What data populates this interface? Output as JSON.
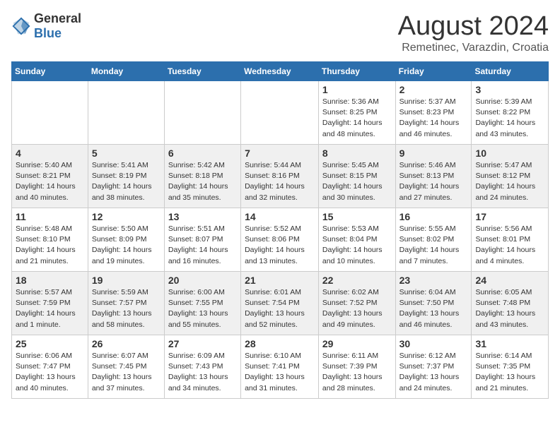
{
  "header": {
    "logo": {
      "general": "General",
      "blue": "Blue"
    },
    "month": "August 2024",
    "location": "Remetinec, Varazdin, Croatia"
  },
  "weekdays": [
    "Sunday",
    "Monday",
    "Tuesday",
    "Wednesday",
    "Thursday",
    "Friday",
    "Saturday"
  ],
  "weeks": [
    [
      {
        "day": "",
        "info": ""
      },
      {
        "day": "",
        "info": ""
      },
      {
        "day": "",
        "info": ""
      },
      {
        "day": "",
        "info": ""
      },
      {
        "day": "1",
        "info": "Sunrise: 5:36 AM\nSunset: 8:25 PM\nDaylight: 14 hours\nand 48 minutes."
      },
      {
        "day": "2",
        "info": "Sunrise: 5:37 AM\nSunset: 8:23 PM\nDaylight: 14 hours\nand 46 minutes."
      },
      {
        "day": "3",
        "info": "Sunrise: 5:39 AM\nSunset: 8:22 PM\nDaylight: 14 hours\nand 43 minutes."
      }
    ],
    [
      {
        "day": "4",
        "info": "Sunrise: 5:40 AM\nSunset: 8:21 PM\nDaylight: 14 hours\nand 40 minutes."
      },
      {
        "day": "5",
        "info": "Sunrise: 5:41 AM\nSunset: 8:19 PM\nDaylight: 14 hours\nand 38 minutes."
      },
      {
        "day": "6",
        "info": "Sunrise: 5:42 AM\nSunset: 8:18 PM\nDaylight: 14 hours\nand 35 minutes."
      },
      {
        "day": "7",
        "info": "Sunrise: 5:44 AM\nSunset: 8:16 PM\nDaylight: 14 hours\nand 32 minutes."
      },
      {
        "day": "8",
        "info": "Sunrise: 5:45 AM\nSunset: 8:15 PM\nDaylight: 14 hours\nand 30 minutes."
      },
      {
        "day": "9",
        "info": "Sunrise: 5:46 AM\nSunset: 8:13 PM\nDaylight: 14 hours\nand 27 minutes."
      },
      {
        "day": "10",
        "info": "Sunrise: 5:47 AM\nSunset: 8:12 PM\nDaylight: 14 hours\nand 24 minutes."
      }
    ],
    [
      {
        "day": "11",
        "info": "Sunrise: 5:48 AM\nSunset: 8:10 PM\nDaylight: 14 hours\nand 21 minutes."
      },
      {
        "day": "12",
        "info": "Sunrise: 5:50 AM\nSunset: 8:09 PM\nDaylight: 14 hours\nand 19 minutes."
      },
      {
        "day": "13",
        "info": "Sunrise: 5:51 AM\nSunset: 8:07 PM\nDaylight: 14 hours\nand 16 minutes."
      },
      {
        "day": "14",
        "info": "Sunrise: 5:52 AM\nSunset: 8:06 PM\nDaylight: 14 hours\nand 13 minutes."
      },
      {
        "day": "15",
        "info": "Sunrise: 5:53 AM\nSunset: 8:04 PM\nDaylight: 14 hours\nand 10 minutes."
      },
      {
        "day": "16",
        "info": "Sunrise: 5:55 AM\nSunset: 8:02 PM\nDaylight: 14 hours\nand 7 minutes."
      },
      {
        "day": "17",
        "info": "Sunrise: 5:56 AM\nSunset: 8:01 PM\nDaylight: 14 hours\nand 4 minutes."
      }
    ],
    [
      {
        "day": "18",
        "info": "Sunrise: 5:57 AM\nSunset: 7:59 PM\nDaylight: 14 hours\nand 1 minute."
      },
      {
        "day": "19",
        "info": "Sunrise: 5:59 AM\nSunset: 7:57 PM\nDaylight: 13 hours\nand 58 minutes."
      },
      {
        "day": "20",
        "info": "Sunrise: 6:00 AM\nSunset: 7:55 PM\nDaylight: 13 hours\nand 55 minutes."
      },
      {
        "day": "21",
        "info": "Sunrise: 6:01 AM\nSunset: 7:54 PM\nDaylight: 13 hours\nand 52 minutes."
      },
      {
        "day": "22",
        "info": "Sunrise: 6:02 AM\nSunset: 7:52 PM\nDaylight: 13 hours\nand 49 minutes."
      },
      {
        "day": "23",
        "info": "Sunrise: 6:04 AM\nSunset: 7:50 PM\nDaylight: 13 hours\nand 46 minutes."
      },
      {
        "day": "24",
        "info": "Sunrise: 6:05 AM\nSunset: 7:48 PM\nDaylight: 13 hours\nand 43 minutes."
      }
    ],
    [
      {
        "day": "25",
        "info": "Sunrise: 6:06 AM\nSunset: 7:47 PM\nDaylight: 13 hours\nand 40 minutes."
      },
      {
        "day": "26",
        "info": "Sunrise: 6:07 AM\nSunset: 7:45 PM\nDaylight: 13 hours\nand 37 minutes."
      },
      {
        "day": "27",
        "info": "Sunrise: 6:09 AM\nSunset: 7:43 PM\nDaylight: 13 hours\nand 34 minutes."
      },
      {
        "day": "28",
        "info": "Sunrise: 6:10 AM\nSunset: 7:41 PM\nDaylight: 13 hours\nand 31 minutes."
      },
      {
        "day": "29",
        "info": "Sunrise: 6:11 AM\nSunset: 7:39 PM\nDaylight: 13 hours\nand 28 minutes."
      },
      {
        "day": "30",
        "info": "Sunrise: 6:12 AM\nSunset: 7:37 PM\nDaylight: 13 hours\nand 24 minutes."
      },
      {
        "day": "31",
        "info": "Sunrise: 6:14 AM\nSunset: 7:35 PM\nDaylight: 13 hours\nand 21 minutes."
      }
    ]
  ]
}
